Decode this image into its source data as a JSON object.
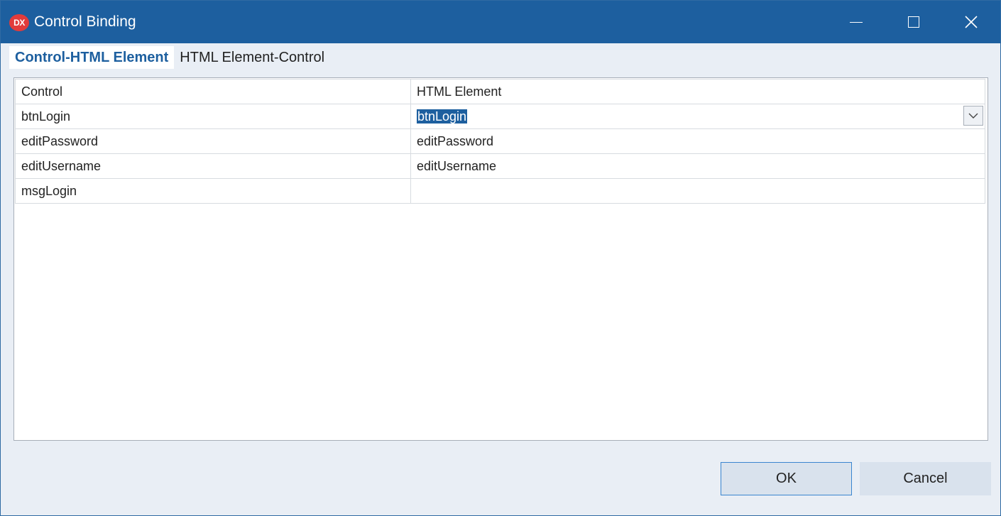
{
  "window": {
    "title": "Control Binding",
    "app_icon_text": "DX"
  },
  "tabs": [
    {
      "label": "Control-HTML Element",
      "active": true
    },
    {
      "label": "HTML Element-Control",
      "active": false
    }
  ],
  "grid": {
    "columns": [
      "Control",
      "HTML Element"
    ],
    "rows": [
      {
        "control": "btnLogin",
        "html_element": "btnLogin",
        "editing": true
      },
      {
        "control": "editPassword",
        "html_element": "editPassword"
      },
      {
        "control": "editUsername",
        "html_element": "editUsername"
      },
      {
        "control": "msgLogin",
        "html_element": ""
      }
    ]
  },
  "buttons": {
    "ok_label": "OK",
    "cancel_label": "Cancel"
  },
  "icons": {
    "minimize": "minimize-icon",
    "maximize": "maximize-icon",
    "close": "close-icon",
    "dropdown": "chevron-down-icon"
  },
  "colors": {
    "titlebar": "#1d5f9f",
    "accent": "#1d5f9f",
    "selection": "#1d5f9f"
  }
}
